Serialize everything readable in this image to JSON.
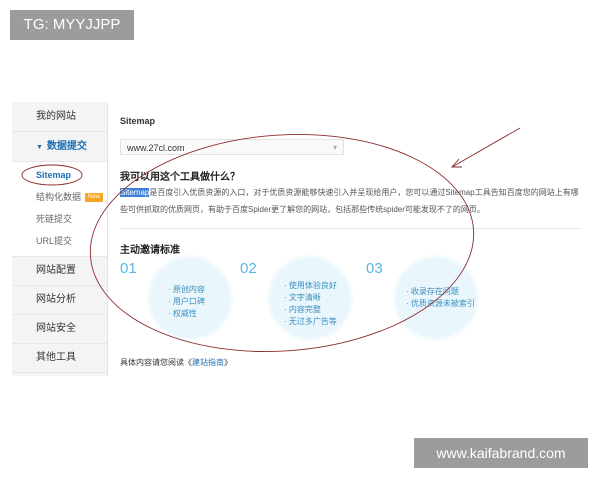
{
  "tag": "TG: MYYJJPP",
  "watermark": "www.kaifabrand.com",
  "sidebar": {
    "items": [
      "我的网站",
      "数据提交"
    ],
    "sub_items": [
      {
        "label": "Sitemap"
      },
      {
        "label": "结构化数据",
        "badge": "New"
      },
      {
        "label": "死链提交"
      },
      {
        "label": "URL提交"
      }
    ],
    "lower_items": [
      "网站配置",
      "网站分析",
      "网站安全",
      "其他工具"
    ]
  },
  "main": {
    "section_title": "Sitemap",
    "site_value": "www.27cl.com",
    "question": "我可以用这个工具做什么？",
    "desc_highlight": "Sitemap",
    "desc_rest": "是百度引入优质资源的入口，对于优质资源能够快速引入并呈现给用户，您可以通过Sitemap工具告知百度您的网站上有哪些可供抓取的优质网页，有助于百度Spider更了解您的网站，包括那些传统spider可能发现不了的网页。",
    "standard_title": "主动邀请标准",
    "columns": [
      {
        "num": "01",
        "items": [
          "原创内容",
          "用户口碑",
          "权威性"
        ]
      },
      {
        "num": "02",
        "items": [
          "使用体验良好",
          "文字清晰",
          "内容完整",
          "无过多广告等"
        ]
      },
      {
        "num": "03",
        "items": [
          "收录存在问题",
          "优质资源未被索引"
        ]
      }
    ],
    "footer_prefix": "具体内容请您阅读《",
    "footer_link": "建站指南",
    "footer_suffix": "》"
  },
  "colors": {
    "accent": "#1f6fb5",
    "annotation": "#8b2a2a",
    "circle_fill": "#e9f6fc"
  }
}
